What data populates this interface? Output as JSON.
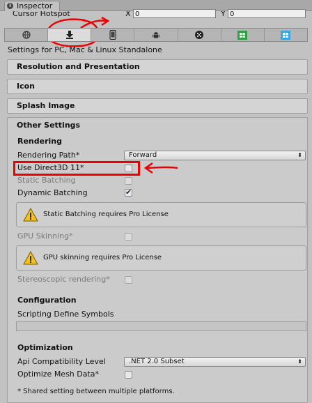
{
  "window": {
    "tab_label": "Inspector",
    "tab_icon": "info-icon"
  },
  "cursor_hotspot": {
    "label": "Cursor Hotspot",
    "x_label": "X",
    "x_value": "0",
    "y_label": "Y",
    "y_value": "0"
  },
  "platforms": {
    "active_index": 1,
    "items": [
      {
        "name": "web",
        "icon": "globe-icon"
      },
      {
        "name": "standalone",
        "icon": "download-icon"
      },
      {
        "name": "ios",
        "icon": "phone-icon"
      },
      {
        "name": "android",
        "icon": "android-icon"
      },
      {
        "name": "blackberry",
        "icon": "blackberry-icon"
      },
      {
        "name": "windows-store",
        "icon": "windows-store-icon"
      },
      {
        "name": "windows-phone",
        "icon": "windows-phone-icon"
      }
    ]
  },
  "settings_for": "Settings for PC, Mac & Linux Standalone",
  "sections": {
    "resolution": "Resolution and Presentation",
    "icon": "Icon",
    "splash": "Splash Image",
    "other": "Other Settings"
  },
  "rendering": {
    "heading": "Rendering",
    "rendering_path_label": "Rendering Path*",
    "rendering_path_value": "Forward",
    "use_d3d11_label": "Use Direct3D 11*",
    "static_batching_label": "Static Batching",
    "dynamic_batching_label": "Dynamic Batching",
    "dynamic_batching_checked": true,
    "static_batching_warning": "Static Batching requires Pro License",
    "gpu_skinning_label": "GPU Skinning*",
    "gpu_skinning_warning": "GPU skinning requires Pro License",
    "stereoscopic_label": "Stereoscopic rendering*"
  },
  "configuration": {
    "heading": "Configuration",
    "scripting_define_label": "Scripting Define Symbols",
    "scripting_define_value": ""
  },
  "optimization": {
    "heading": "Optimization",
    "api_label": "Api Compatibility Level",
    "api_value": ".NET 2.0 Subset",
    "optimize_mesh_label": "Optimize Mesh Data*"
  },
  "footnote": "* Shared setting between multiple platforms.",
  "colors": {
    "annotation": "#ee0000",
    "warning": "#f3c21a"
  }
}
